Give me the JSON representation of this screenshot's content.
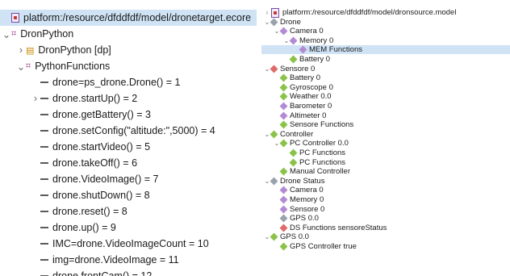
{
  "left": {
    "rows": [
      {
        "label": "platform:/resource/dfddfdf/model/dronetarget.ecore",
        "depth": 0,
        "twisty": "",
        "icon": "doc-icon",
        "sel": true
      },
      {
        "label": "DronPython",
        "depth": 0,
        "twisty": "⌄",
        "icon": "package-icon"
      },
      {
        "label": "DronPython [dp]",
        "depth": 1,
        "twisty": "›",
        "icon": "class-icon"
      },
      {
        "label": "PythonFunctions",
        "depth": 1,
        "twisty": "⌄",
        "icon": "package-icon"
      },
      {
        "label": "drone=ps_drone.Drone() = 1",
        "depth": 2,
        "twisty": "",
        "icon": "operation-icon"
      },
      {
        "label": "drone.startUp() = 2",
        "depth": 2,
        "twisty": "›",
        "icon": "operation-icon"
      },
      {
        "label": "drone.getBattery() = 3",
        "depth": 2,
        "twisty": "",
        "icon": "operation-icon"
      },
      {
        "label": "drone.setConfig(\"altitude:\",5000) = 4",
        "depth": 2,
        "twisty": "",
        "icon": "operation-icon"
      },
      {
        "label": "drone.startVideo() = 5",
        "depth": 2,
        "twisty": "",
        "icon": "operation-icon"
      },
      {
        "label": "drone.takeOff() = 6",
        "depth": 2,
        "twisty": "",
        "icon": "operation-icon"
      },
      {
        "label": "drone.VideoImage() = 7",
        "depth": 2,
        "twisty": "",
        "icon": "operation-icon"
      },
      {
        "label": "drone.shutDown() = 8",
        "depth": 2,
        "twisty": "",
        "icon": "operation-icon"
      },
      {
        "label": "drone.reset() = 8",
        "depth": 2,
        "twisty": "",
        "icon": "operation-icon"
      },
      {
        "label": "drone.up() = 9",
        "depth": 2,
        "twisty": "",
        "icon": "operation-icon"
      },
      {
        "label": "IMC=drone.VideoImageCount = 10",
        "depth": 2,
        "twisty": "",
        "icon": "operation-icon"
      },
      {
        "label": "img=drone.VideoImage = 11",
        "depth": 2,
        "twisty": "",
        "icon": "operation-icon"
      },
      {
        "label": "drone.frontCam() = 12",
        "depth": 2,
        "twisty": "",
        "icon": "operation-icon"
      }
    ]
  },
  "right": {
    "rows": [
      {
        "label": "platform:/resource/dfddfdf/model/dronsource.model",
        "depth": 0,
        "twisty": "›",
        "icon": "doc-icon"
      },
      {
        "label": "Drone",
        "depth": 0,
        "twisty": "⌄",
        "icon": "diamond-gray-icon"
      },
      {
        "label": "Camera 0",
        "depth": 1,
        "twisty": "⌄",
        "icon": "diamond-purple-icon"
      },
      {
        "label": "Memory 0",
        "depth": 2,
        "twisty": "⌄",
        "icon": "diamond-purple-icon"
      },
      {
        "label": "MEM Functions",
        "depth": 3,
        "twisty": "",
        "icon": "diamond-purple-icon",
        "sel": true
      },
      {
        "label": "Battery 0",
        "depth": 2,
        "twisty": "",
        "icon": "diamond-green-icon"
      },
      {
        "label": "Sensore 0",
        "depth": 0,
        "twisty": "⌄",
        "icon": "diamond-red-icon"
      },
      {
        "label": "Battery 0",
        "depth": 1,
        "twisty": "",
        "icon": "diamond-green-icon"
      },
      {
        "label": "Gyroscope 0",
        "depth": 1,
        "twisty": "",
        "icon": "diamond-green-icon"
      },
      {
        "label": "Weather 0.0",
        "depth": 1,
        "twisty": "",
        "icon": "diamond-green-icon"
      },
      {
        "label": "Barometer 0",
        "depth": 1,
        "twisty": "",
        "icon": "diamond-purple-icon"
      },
      {
        "label": "Altimeter 0",
        "depth": 1,
        "twisty": "",
        "icon": "diamond-purple-icon"
      },
      {
        "label": "Sensore Functions",
        "depth": 1,
        "twisty": "",
        "icon": "diamond-green-icon"
      },
      {
        "label": "Controller",
        "depth": 0,
        "twisty": "⌄",
        "icon": "diamond-green-icon"
      },
      {
        "label": "PC Controller 0.0",
        "depth": 1,
        "twisty": "⌄",
        "icon": "diamond-green-icon"
      },
      {
        "label": "PC Functions",
        "depth": 2,
        "twisty": "",
        "icon": "diamond-green-icon"
      },
      {
        "label": "PC Functions",
        "depth": 2,
        "twisty": "",
        "icon": "diamond-green-icon"
      },
      {
        "label": "Manual Controller",
        "depth": 1,
        "twisty": "",
        "icon": "diamond-green-icon"
      },
      {
        "label": "Drone Status",
        "depth": 0,
        "twisty": "⌄",
        "icon": "diamond-gray-icon"
      },
      {
        "label": "Camera 0",
        "depth": 1,
        "twisty": "",
        "icon": "diamond-purple-icon"
      },
      {
        "label": "Memory 0",
        "depth": 1,
        "twisty": "",
        "icon": "diamond-purple-icon"
      },
      {
        "label": "Sensore 0",
        "depth": 1,
        "twisty": "",
        "icon": "diamond-purple-icon"
      },
      {
        "label": "GPS 0.0",
        "depth": 1,
        "twisty": "",
        "icon": "diamond-gray-icon"
      },
      {
        "label": "DS Functions sensoreStatus",
        "depth": 1,
        "twisty": "",
        "icon": "diamond-red-icon"
      },
      {
        "label": "GPS 0.0",
        "depth": 0,
        "twisty": "⌄",
        "icon": "diamond-green-icon"
      },
      {
        "label": "GPS Controller true",
        "depth": 1,
        "twisty": "",
        "icon": "diamond-green-icon"
      }
    ]
  }
}
